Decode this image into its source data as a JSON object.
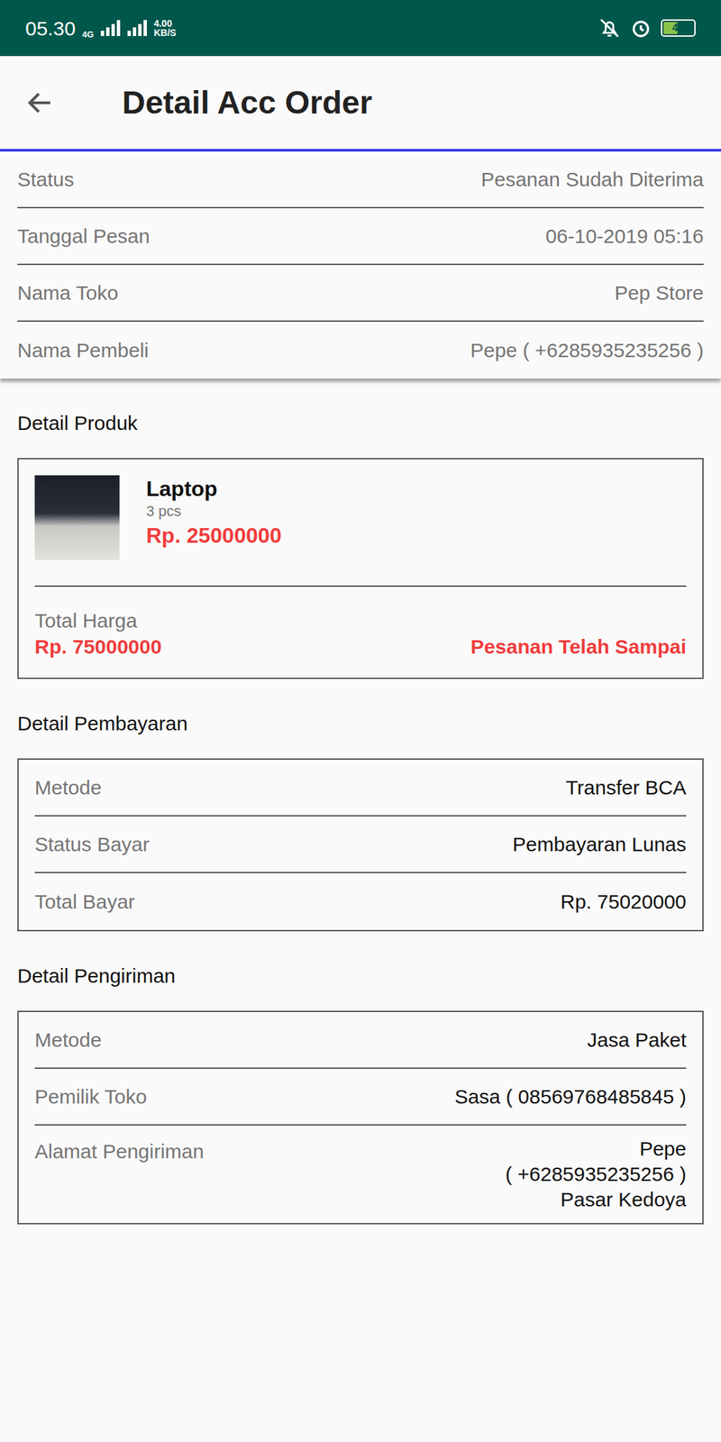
{
  "status_bar": {
    "time": "05.30",
    "network": "4G",
    "speed": "4.00",
    "speed_unit": "KB/S",
    "battery": "47",
    "battery_level": 0.47
  },
  "app_bar": {
    "title": "Detail Acc Order"
  },
  "info": [
    {
      "label": "Status",
      "value": "Pesanan Sudah Diterima"
    },
    {
      "label": "Tanggal Pesan",
      "value": "06-10-2019 05:16"
    },
    {
      "label": "Nama Toko",
      "value": "Pep Store"
    },
    {
      "label": "Nama Pembeli",
      "value": "Pepe ( +6285935235256 )"
    }
  ],
  "product_section": {
    "title": "Detail Produk",
    "products": [
      {
        "name": "Laptop",
        "qty": "3 pcs",
        "price": "Rp. 25000000"
      }
    ],
    "total_label": "Total Harga",
    "total": "Rp. 75000000",
    "order_status": "Pesanan Telah Sampai"
  },
  "payment_section": {
    "title": "Detail Pembayaran",
    "rows": [
      {
        "label": "Metode",
        "value": "Transfer BCA"
      },
      {
        "label": "Status Bayar",
        "value": "Pembayaran Lunas"
      },
      {
        "label": "Total Bayar",
        "value": "Rp. 75020000"
      }
    ]
  },
  "shipping_section": {
    "title": "Detail Pengiriman",
    "rows": [
      {
        "label": "Metode",
        "lines": [
          "Jasa Paket"
        ]
      },
      {
        "label": "Pemilik Toko",
        "lines": [
          "Sasa ( 08569768485845 )"
        ]
      },
      {
        "label": "Alamat Pengiriman",
        "lines": [
          "Pepe",
          "( +6285935235256 )",
          "Pasar Kedoya"
        ]
      }
    ]
  }
}
